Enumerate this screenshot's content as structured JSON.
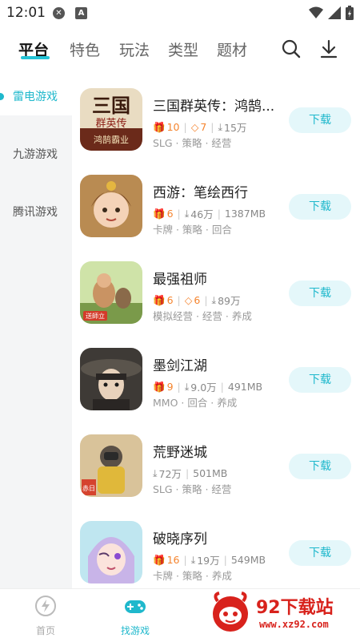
{
  "status_bar": {
    "time": "12:01"
  },
  "top_tabs": [
    "平台",
    "特色",
    "玩法",
    "类型",
    "题材"
  ],
  "sidebar": {
    "items": [
      "雷电游戏",
      "九游游戏",
      "腾讯游戏"
    ],
    "active": 0
  },
  "games": [
    {
      "title": "三国群英传：鸿鹄...",
      "stats": [
        {
          "icon": "gift",
          "value": "10",
          "hl": true
        },
        {
          "icon": "diamond",
          "value": "7",
          "hl": true
        },
        {
          "icon": "download",
          "value": "15万",
          "hl": false
        }
      ],
      "tags": "SLG · 策略 · 经营",
      "button": "下载"
    },
    {
      "title": "西游：笔绘西行",
      "stats": [
        {
          "icon": "gift",
          "value": "6",
          "hl": true
        },
        {
          "icon": "download",
          "value": "46万",
          "hl": false
        },
        {
          "icon": "",
          "value": "1387MB",
          "hl": false
        }
      ],
      "tags": "卡牌 · 策略 · 回合",
      "button": "下载"
    },
    {
      "title": "最强祖师",
      "stats": [
        {
          "icon": "gift",
          "value": "6",
          "hl": true
        },
        {
          "icon": "diamond",
          "value": "6",
          "hl": true
        },
        {
          "icon": "download",
          "value": "89万",
          "hl": false
        }
      ],
      "tags": "模拟经营 · 经营 · 养成",
      "button": "下载"
    },
    {
      "title": "墨剑江湖",
      "stats": [
        {
          "icon": "gift",
          "value": "9",
          "hl": true
        },
        {
          "icon": "download",
          "value": "9.0万",
          "hl": false
        },
        {
          "icon": "",
          "value": "491MB",
          "hl": false
        }
      ],
      "tags": "MMO · 回合 · 养成",
      "button": "下载"
    },
    {
      "title": "荒野迷城",
      "stats": [
        {
          "icon": "download",
          "value": "72万",
          "hl": false
        },
        {
          "icon": "",
          "value": "501MB",
          "hl": false
        }
      ],
      "tags": "SLG · 策略 · 经营",
      "button": "下载"
    },
    {
      "title": "破晓序列",
      "stats": [
        {
          "icon": "gift",
          "value": "16",
          "hl": true
        },
        {
          "icon": "download",
          "value": "19万",
          "hl": false
        },
        {
          "icon": "",
          "value": "549MB",
          "hl": false
        }
      ],
      "tags": "卡牌 · 策略 · 养成",
      "button": "下载"
    }
  ],
  "bottom_nav": [
    {
      "label": "首页",
      "active": false
    },
    {
      "label": "找游戏",
      "active": true
    }
  ],
  "watermark": {
    "brand": "92下载站",
    "url": "www.xz92.com"
  },
  "colors": {
    "accent": "#1fb8cc",
    "orange": "#f5842e"
  }
}
